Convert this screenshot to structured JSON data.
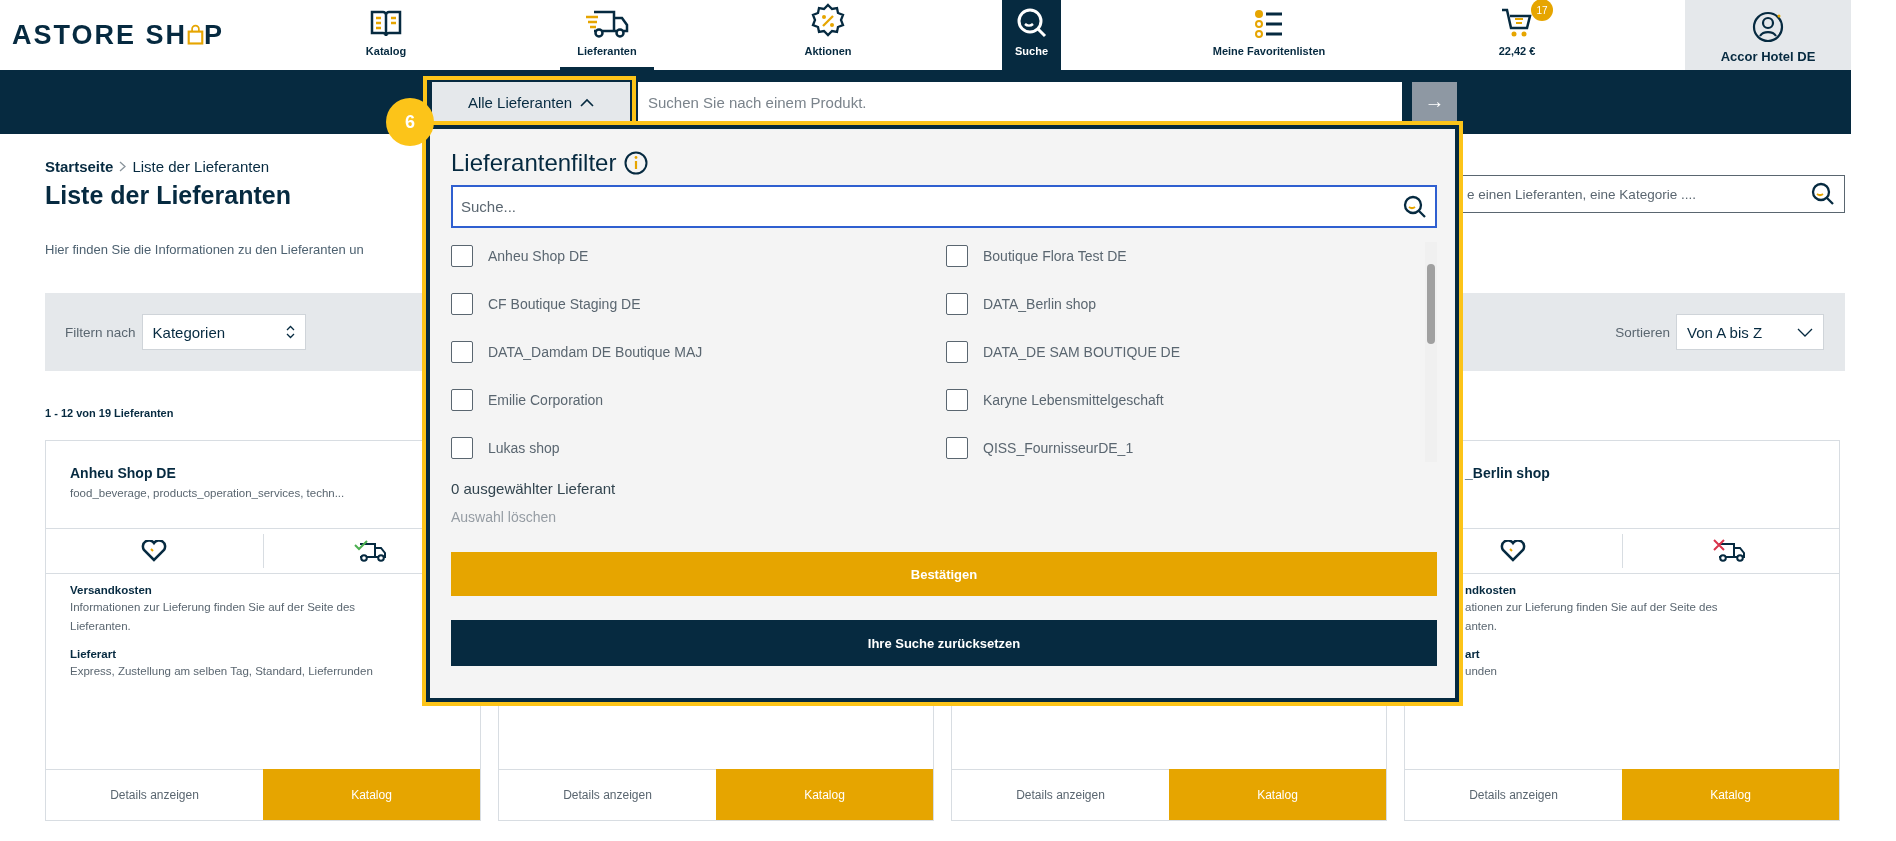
{
  "header": {
    "logo": {
      "before": "ASTORE SH",
      "after": "P"
    },
    "nav": [
      {
        "label": "Katalog",
        "selected": false,
        "expanded": false
      },
      {
        "label": "Lieferanten",
        "selected": true,
        "expanded": false
      },
      {
        "label": "Aktionen",
        "selected": false,
        "expanded": false
      },
      {
        "label": "Suche",
        "selected": false,
        "expanded": true
      },
      {
        "label": "Meine Favoritenlisten",
        "selected": false,
        "expanded": false
      },
      {
        "label": "22,42 €",
        "badge": "17",
        "selected": false,
        "expanded": false
      }
    ],
    "account": {
      "label": "Accor Hotel DE"
    }
  },
  "search_bar": {
    "supplier_button": {
      "label": "Alle Lieferanten",
      "expanded": true
    },
    "placeholder": "Suchen Sie nach einem Produkt.",
    "submit": "→"
  },
  "step_badge": "6",
  "supplier_filter": {
    "title": "Lieferantenfilter",
    "search_placeholder": "Suche...",
    "options": [
      {
        "label": "Anheu Shop DE",
        "checked": false
      },
      {
        "label": "Boutique Flora Test DE",
        "checked": false
      },
      {
        "label": "CF Boutique Staging DE",
        "checked": false
      },
      {
        "label": "DATA_Berlin shop",
        "checked": false
      },
      {
        "label": "DATA_Damdam DE Boutique MAJ",
        "checked": false
      },
      {
        "label": "DATA_DE SAM BOUTIQUE DE",
        "checked": false
      },
      {
        "label": "Emilie Corporation",
        "checked": false
      },
      {
        "label": "Karyne Lebensmittelgeschaft",
        "checked": false
      },
      {
        "label": "Lukas shop",
        "checked": false
      },
      {
        "label": "QISS_FournisseurDE_1",
        "checked": false
      }
    ],
    "selected_count": "0 ausgewählter Lieferant",
    "clear": {
      "label": "Auswahl löschen",
      "disabled": true
    },
    "confirm": "Bestätigen",
    "reset": "Ihre Suche zurücksetzen"
  },
  "breadcrumb": [
    {
      "label": "Startseite"
    },
    {
      "label": "Liste der Lieferanten"
    }
  ],
  "page_title": "Liste der Lieferanten",
  "supplier_search": {
    "placeholder": "e einen Lieferanten, eine Kategorie ...."
  },
  "intro": "Hier finden Sie die Informationen zu den Lieferanten un",
  "filter_bar": {
    "filter_label": "Filtern nach",
    "filter_value": "Kategorien",
    "sort_label": "Sortieren",
    "sort_value": "Von A bis Z"
  },
  "result_count": "1 - 12 von 19 Lieferanten",
  "cards": [
    {
      "name": "Anheu Shop DE",
      "categories": "food_beverage, products_operation_services, techn...",
      "delivery_available": true,
      "shipping_title": "Versandkosten",
      "shipping_text": "Informationen zur Lieferung finden Sie auf der Seite des Lieferanten.",
      "delivery_title": "Lieferart",
      "delivery_text": "Express, Zustellung am selben Tag, Standard, Lieferrunden",
      "details": "Details anzeigen",
      "catalog": "Katalog"
    },
    {
      "details": "Details anzeigen",
      "catalog": "Katalog"
    },
    {
      "details": "Details anzeigen",
      "catalog": "Katalog"
    },
    {
      "name": "_Berlin shop",
      "partial": true,
      "delivery_available": false,
      "shipping_title": "ndkosten",
      "shipping_text": "ationen zur Lieferung finden Sie auf der Seite des anten.",
      "delivery_title": "art",
      "delivery_text": "unden",
      "details": "Details anzeigen",
      "catalog": "Katalog"
    }
  ]
}
